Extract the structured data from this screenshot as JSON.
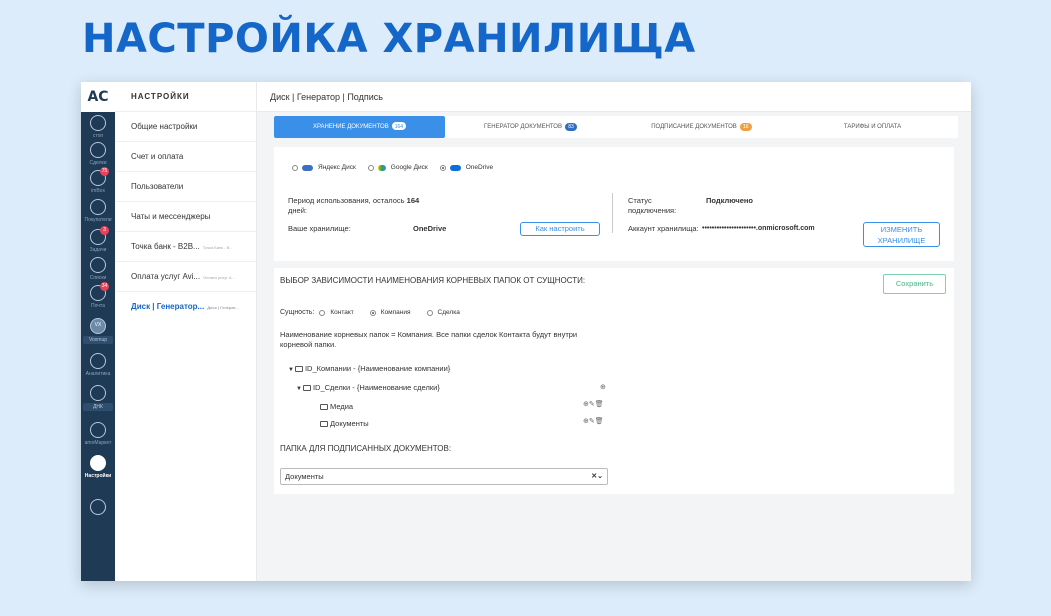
{
  "hero": {
    "title": "НАСТРОЙКА ХРАНИЛИЩА"
  },
  "leftbar": {
    "logo": "AC",
    "items": [
      {
        "icon": "stop-icon",
        "label": "стоп"
      },
      {
        "icon": "deals-icon",
        "label": "Сделки"
      },
      {
        "icon": "inbox-icon",
        "label": "imBox",
        "badge": "75"
      },
      {
        "icon": "buyers-icon",
        "label": "Покупатели"
      },
      {
        "icon": "tasks-icon",
        "label": "Задачи",
        "badge": "3"
      },
      {
        "icon": "lists-icon",
        "label": "Списки"
      },
      {
        "icon": "mail-icon",
        "label": "Почта",
        "badge": "34"
      },
      {
        "icon": "voximplant-icon",
        "label": "Voxmup",
        "avatar": "VX"
      },
      {
        "icon": "analytics-icon",
        "label": "Аналитика"
      },
      {
        "icon": "dnk-icon",
        "label": "ДНК"
      },
      {
        "icon": "market-icon",
        "label": "amoМаркет"
      },
      {
        "icon": "settings-icon",
        "label": "Настройки",
        "active": true
      },
      {
        "icon": "profile-icon",
        "label": ""
      }
    ]
  },
  "submenu": {
    "title": "НАСТРОЙКИ",
    "items": [
      {
        "label": "Общие настройки",
        "sub": ""
      },
      {
        "label": "Счет и оплата",
        "sub": ""
      },
      {
        "label": "Пользователи",
        "sub": ""
      },
      {
        "label": "Чаты и мессенджеры",
        "sub": ""
      },
      {
        "label": "Точка банк - B2B...",
        "sub": "Точка Банк - B..."
      },
      {
        "label": "Оплата услуг Avi...",
        "sub": "Оплата услуг А..."
      },
      {
        "label": "Диск | Генератор...",
        "sub": "Диск | Генерат...",
        "active": true
      }
    ]
  },
  "breadcrumb": "Диск | Генератор | Подпись",
  "tabs": [
    {
      "label": "ХРАНЕНИЕ ДОКУМЕНТОВ",
      "count": "164",
      "active": true
    },
    {
      "label": "ГЕНЕРАТОР ДОКУМЕНТОВ",
      "count": "83"
    },
    {
      "label": "ПОДПИСАНИЕ ДОКУМЕНТОВ",
      "count": "16",
      "orange": true
    },
    {
      "label": "ТАРИФЫ И ОПЛАТА",
      "count": ""
    }
  ],
  "storage": {
    "options": [
      "Яндекс Диск",
      "Google Диск",
      "OneDrive"
    ],
    "selected": "OneDrive",
    "period_label": "Период использования, осталось",
    "period_days": "164",
    "period_suffix": "дней:",
    "your_storage_label": "Ваше хранилище:",
    "your_storage_value": "OneDrive",
    "howto_button": "Как настроить",
    "status_label_1": "Статус",
    "status_label_2": "подключения:",
    "status_value": "Подключено",
    "account_label": "Аккаунт хранилища:",
    "account_value": "••••••••••••••••••••••.onmicrosoft.com",
    "change_button_1": "ИЗМЕНИТЬ",
    "change_button_2": "ХРАНИЛИЩЕ"
  },
  "folders": {
    "title": "ВЫБОР ЗАВИСИМОСТИ НАИМЕНОВАНИЯ КОРНЕВЫХ ПАПОК ОТ СУЩНОСТИ:",
    "save_button": "Сохранить",
    "entity_label": "Сущность:",
    "entities": [
      "Контакт",
      "Компания",
      "Сделка"
    ],
    "selected_entity": "Компания",
    "note_1": "Наименование корневых папок = Компания. Все папки сделок Контакта будут внутри",
    "note_2": "корневой папки.",
    "tree": [
      "ID_Компании - {Наименование компании}",
      "ID_Сделки - {Наименование сделки}",
      "Медиа",
      "Документы"
    ],
    "signed_title": "ПАПКА ДЛЯ ПОДПИСАННЫХ ДОКУМЕНТОВ:",
    "signed_value": "Документы"
  }
}
